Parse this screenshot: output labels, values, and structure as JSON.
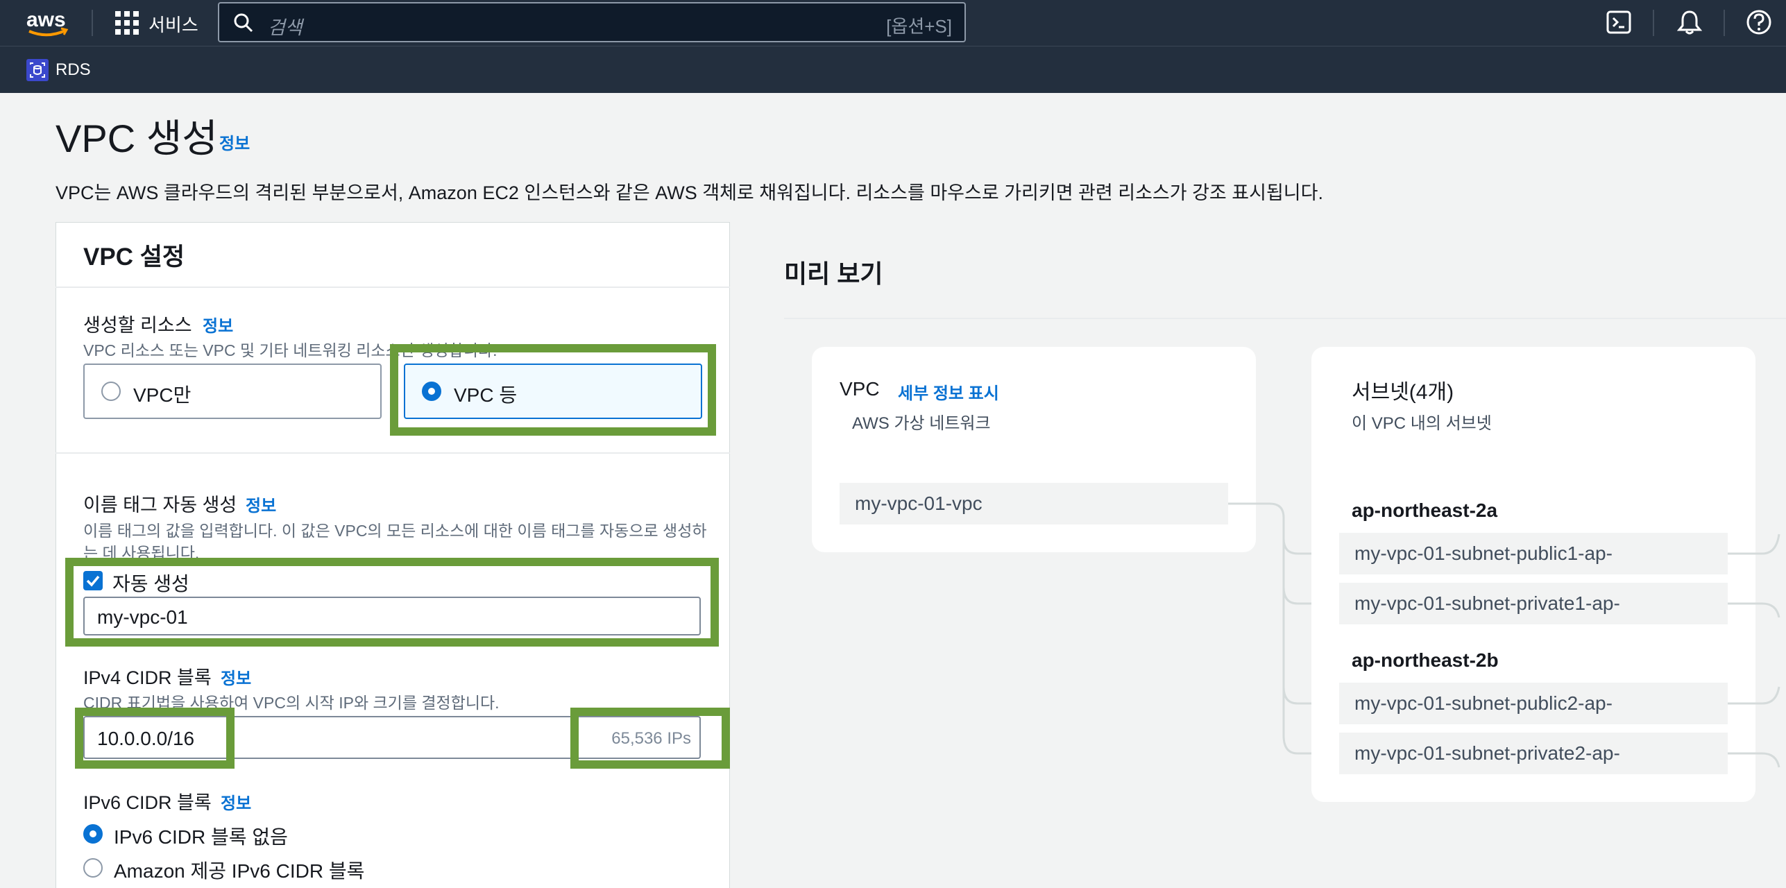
{
  "nav": {
    "services_label": "서비스",
    "search_placeholder": "검색",
    "search_shortcut": "[옵션+S]",
    "breadcrumb_service": "RDS"
  },
  "page": {
    "title": "VPC 생성",
    "title_info": "정보",
    "description": "VPC는 AWS 클라우드의 격리된 부분으로서, Amazon EC2 인스턴스와 같은 AWS 객체로 채워집니다. 리소스를 마우스로 가리키면 관련 리소스가 강조 표시됩니다."
  },
  "vpc_settings": {
    "heading": "VPC 설정",
    "resources": {
      "label": "생성할 리소스",
      "info": "정보",
      "description": "VPC 리소스 또는 VPC 및 기타 네트워킹 리소스만 생성합니다.",
      "option_vpc_only": "VPC만",
      "option_vpc_more": "VPC 등",
      "selected": "VPC 등"
    },
    "name_tag": {
      "label": "이름 태그 자동 생성",
      "info": "정보",
      "description_line1": "이름 태그의 값을 입력합니다. 이 값은 VPC의 모든 리소스에 대한 이름 태그를 자동으로 생성하",
      "description_line2": "는 데 사용됩니다.",
      "checkbox_label": "자동 생성",
      "checked": true,
      "value": "my-vpc-01"
    },
    "ipv4": {
      "label": "IPv4 CIDR 블록",
      "info": "정보",
      "description": "CIDR 표기법을 사용하여 VPC의 시작 IP와 크기를 결정합니다.",
      "value": "10.0.0.0/16",
      "ip_count": "65,536 IPs"
    },
    "ipv6": {
      "label": "IPv6 CIDR 블록",
      "info": "정보",
      "option_none": "IPv6 CIDR 블록 없음",
      "option_amazon": "Amazon 제공 IPv6 CIDR 블록",
      "selected": "IPv6 CIDR 블록 없음"
    }
  },
  "preview": {
    "heading": "미리 보기",
    "vpc_card": {
      "title": "VPC",
      "details_link": "세부 정보 표시",
      "subtitle": "AWS 가상 네트워크",
      "vpc_name": "my-vpc-01-vpc"
    },
    "subnet_card": {
      "title": "서브넷(4개)",
      "subtitle": "이 VPC 내의 서브넷",
      "zones": [
        {
          "name": "ap-northeast-2a",
          "subnets": [
            "my-vpc-01-subnet-public1-ap-",
            "my-vpc-01-subnet-private1-ap-"
          ]
        },
        {
          "name": "ap-northeast-2b",
          "subnets": [
            "my-vpc-01-subnet-public2-ap-",
            "my-vpc-01-subnet-private2-ap-"
          ]
        }
      ]
    }
  },
  "colors": {
    "nav_bg": "#232f3e",
    "link": "#0972d3",
    "highlight": "#6a9c3a"
  }
}
